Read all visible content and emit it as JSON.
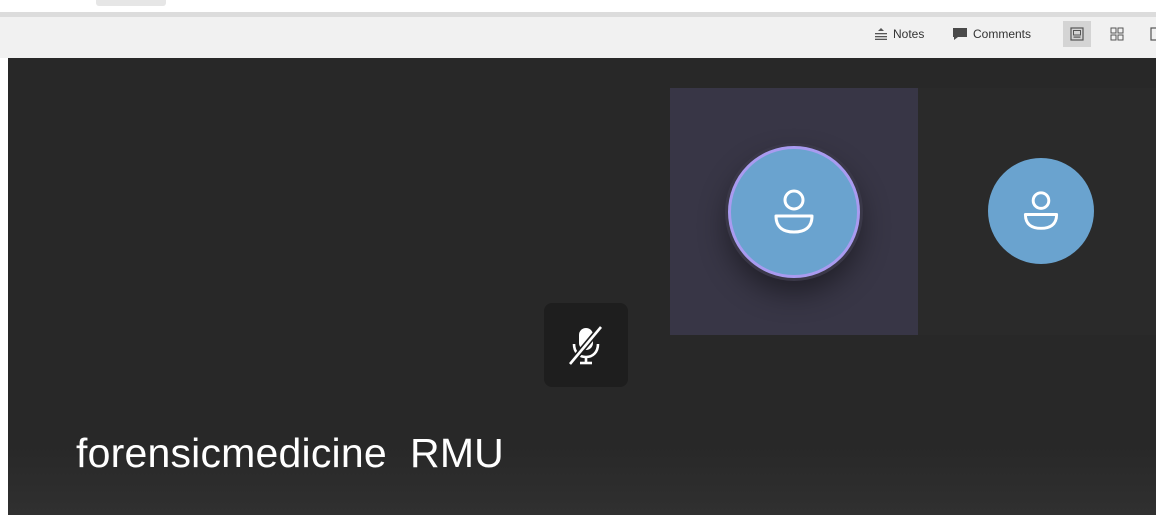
{
  "statusbar": {
    "notes_label": "Notes",
    "comments_label": "Comments",
    "icons": {
      "notes": "notes-icon",
      "comments": "comment-bubble-icon",
      "normal_view": "normal-view-icon",
      "slide_sorter": "slide-sorter-icon",
      "reading_view": "reading-view-icon"
    }
  },
  "meeting": {
    "participant_name": "forensicmedicine  RMU",
    "participants": [
      {
        "state": "speaking",
        "avatar_icon": "person-icon"
      },
      {
        "state": "idle",
        "avatar_icon": "person-icon"
      }
    ],
    "mic_icon": "mic-muted-icon"
  },
  "colors": {
    "stage_background": "#282828",
    "active_tile": "#383646",
    "avatar": "#6aa3cf",
    "speaking_ring": "#a99bf0",
    "statusbar_background": "#f1f1f1"
  }
}
